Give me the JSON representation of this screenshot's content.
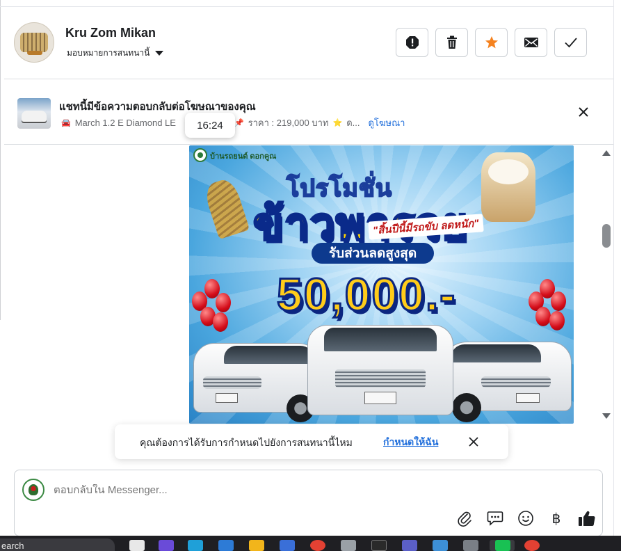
{
  "header": {
    "name": "Kru Zom Mikan",
    "assign_label": "มอบหมายการสนทนานี้",
    "buttons": [
      "report",
      "delete",
      "star",
      "mark-unread",
      "done"
    ]
  },
  "ad": {
    "title": "แชทนี้มีข้อความตอบกลับต่อโฆษณาของคุณ",
    "detail": "March 1.2 E Diamond LE",
    "price": "ราคา : 219,000 บาท",
    "detail_more": "ด...",
    "link": "ดูโฆษณา",
    "tooltip_time": "16:24"
  },
  "promo": {
    "brand": "บ้านรถยนต์ ดอกคูณ",
    "headline_top": "โปรโมชั่น",
    "headline_big": "ข้าวพารวย",
    "slogan": "\"สิ้นปีนี้มีรถขับ ลดหนัก\"",
    "discount_label": "รับส่วนลดสูงสุด",
    "amount": "50,000.-"
  },
  "assign_prompt": {
    "text": "คุณต้องการได้รับการกำหนดไปยังการสนทนานี้ไหม",
    "link": "กำหนดให้ฉัน"
  },
  "composer": {
    "placeholder": "ตอบกลับใน Messenger...",
    "currency_icon": "฿"
  },
  "taskbar": {
    "search_text": "earch"
  },
  "colors": {
    "link": "#216fdb",
    "star": "#f5821f",
    "text": "#1c1e21",
    "muted": "#65676b"
  }
}
